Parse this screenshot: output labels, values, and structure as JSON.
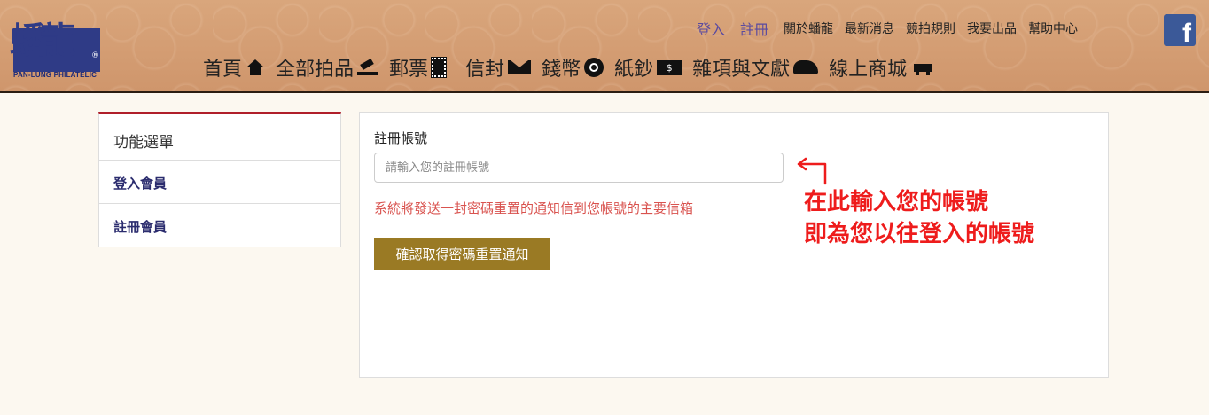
{
  "logo": {
    "chars": "蟠龍",
    "reg": "®",
    "subtitle": "PAN-LUNG PHILATELIC"
  },
  "top_links": {
    "login": "登入",
    "register": "註冊",
    "items": [
      "關於蟠龍",
      "最新消息",
      "競拍規則",
      "我要出品",
      "幫助中心"
    ]
  },
  "facebook_label": "f",
  "main_nav": [
    {
      "label": "首頁",
      "icon": "home-icon"
    },
    {
      "label": "全部拍品",
      "icon": "gavel-icon"
    },
    {
      "label": "郵票",
      "icon": "stamp-icon"
    },
    {
      "label": "信封",
      "icon": "envelope-icon"
    },
    {
      "label": "錢幣",
      "icon": "coin-icon"
    },
    {
      "label": "紙鈔",
      "icon": "banknote-icon"
    },
    {
      "label": "雜項與文獻",
      "icon": "shoe-icon"
    },
    {
      "label": "線上商城",
      "icon": "cart-icon"
    }
  ],
  "banknote_symbol": "$",
  "sidebar": {
    "title": "功能選單",
    "items": [
      {
        "label": "登入會員"
      },
      {
        "label": "註冊會員"
      }
    ]
  },
  "form": {
    "label": "註冊帳號",
    "placeholder": "請輸入您的註冊帳號",
    "hint": "系統將發送一封密碼重置的通知信到您帳號的主要信箱",
    "submit_label": "確認取得密碼重置通知"
  },
  "annotation": {
    "line1": "在此輸入您的帳號",
    "line2": "即為您以往登入的帳號"
  },
  "colors": {
    "header": "#d39c72",
    "brand_blue": "#2f3b86",
    "accent_red": "#b01f2a",
    "button_gold": "#9a7a24",
    "hint_red": "#d9534f",
    "annotation_red": "#ee1c1c"
  }
}
